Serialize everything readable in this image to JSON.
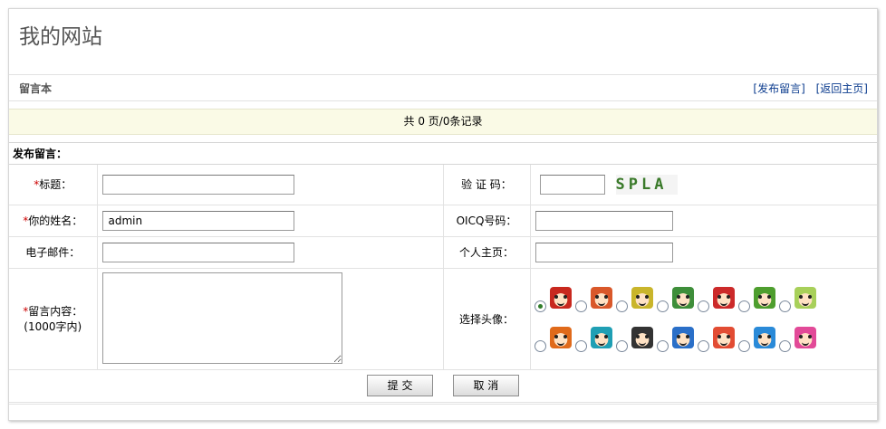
{
  "site": {
    "title": "我的网站"
  },
  "guestbook": {
    "title": "留言本",
    "links": {
      "post": "[发布留言]",
      "home": "[返回主页]"
    },
    "record_text": "共 0 页/0条记录",
    "form_title": "发布留言："
  },
  "form": {
    "required_mark": "*",
    "subject_label": "标题：",
    "captcha_label": "验 证 码：",
    "captcha_text": "SPLA",
    "name_label": "你的姓名：",
    "name_value": "admin",
    "oicq_label": "OICQ号码：",
    "email_label": "电子邮件：",
    "homepage_label": "个人主页：",
    "content_label": "留言内容：",
    "content_hint": "(1000字内)",
    "avatar_label": "选择头像：",
    "avatars": [
      {
        "icon": "panda-red-hair-icon",
        "color": "#c8281e",
        "selected": true
      },
      {
        "icon": "red-frog-icon",
        "color": "#d9582a",
        "selected": false
      },
      {
        "icon": "yellow-face-icon",
        "color": "#c9b52b",
        "selected": false
      },
      {
        "icon": "green-turtle-icon",
        "color": "#3e8e3a",
        "selected": false
      },
      {
        "icon": "red-hair-girl-icon",
        "color": "#cc2a2a",
        "selected": false
      },
      {
        "icon": "green-frog-icon",
        "color": "#4e9e2e",
        "selected": false
      },
      {
        "icon": "yellow-chick-icon",
        "color": "#a8d05a",
        "selected": false
      },
      {
        "icon": "carrot-icon",
        "color": "#e06a1a",
        "selected": false
      },
      {
        "icon": "teal-hair-girl-icon",
        "color": "#1f9fb4",
        "selected": false
      },
      {
        "icon": "dark-hair-boy-icon",
        "color": "#333333",
        "selected": false
      },
      {
        "icon": "blue-cap-boy-icon",
        "color": "#2a6fc8",
        "selected": false
      },
      {
        "icon": "red-pig-icon",
        "color": "#e24c33",
        "selected": false
      },
      {
        "icon": "blue-hair-boy-icon",
        "color": "#2a8ad8",
        "selected": false
      },
      {
        "icon": "pink-hair-girl-icon",
        "color": "#e24a98",
        "selected": false
      }
    ],
    "submit_label": "提 交",
    "cancel_label": "取 消"
  }
}
